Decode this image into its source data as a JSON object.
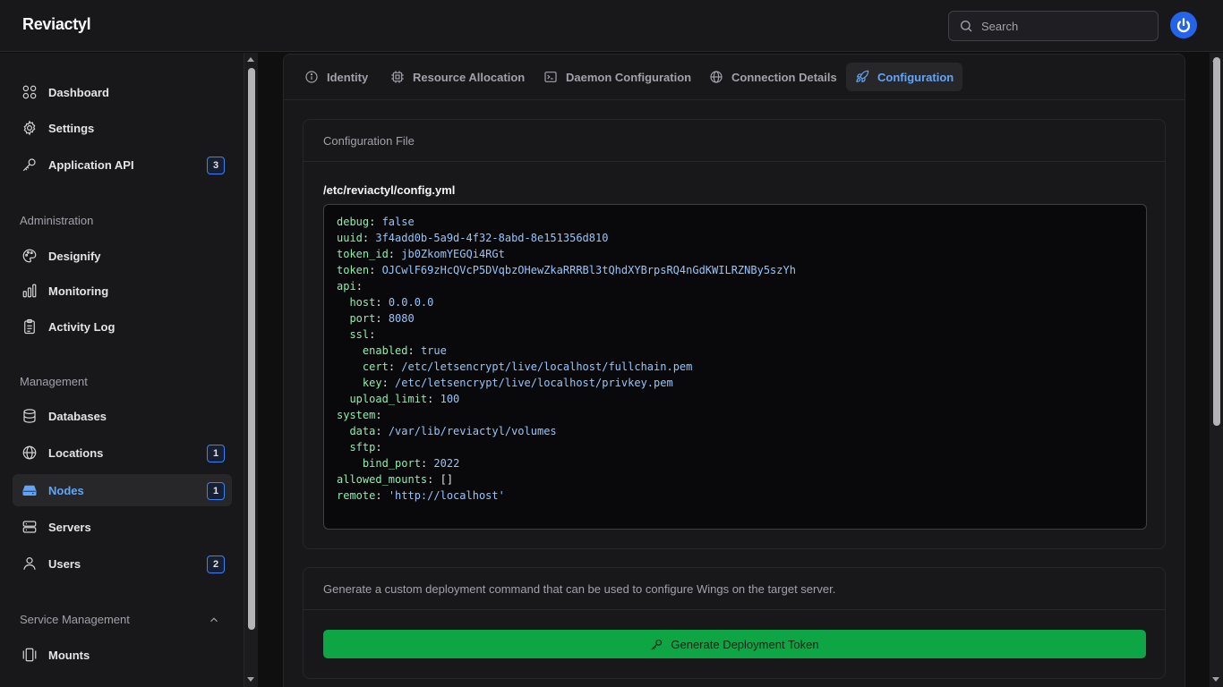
{
  "app": {
    "title": "Reviactyl"
  },
  "search": {
    "placeholder": "Search"
  },
  "sidebar": {
    "top_items": [
      {
        "label": "Dashboard",
        "icon": "grid-icon"
      },
      {
        "label": "Settings",
        "icon": "gear-icon"
      },
      {
        "label": "Application API",
        "icon": "key-icon",
        "badge": "3"
      }
    ],
    "sections": [
      {
        "label": "Administration",
        "items": [
          {
            "label": "Designify",
            "icon": "palette-icon"
          },
          {
            "label": "Monitoring",
            "icon": "bar-chart-icon"
          },
          {
            "label": "Activity Log",
            "icon": "clipboard-icon"
          }
        ]
      },
      {
        "label": "Management",
        "items": [
          {
            "label": "Databases",
            "icon": "database-icon"
          },
          {
            "label": "Locations",
            "icon": "globe-icon",
            "badge": "1"
          },
          {
            "label": "Nodes",
            "icon": "hard-drive-icon",
            "badge": "1",
            "active": true
          },
          {
            "label": "Servers",
            "icon": "server-icon"
          },
          {
            "label": "Users",
            "icon": "user-icon",
            "badge": "2"
          }
        ]
      },
      {
        "label": "Service Management",
        "items": [
          {
            "label": "Mounts",
            "icon": "mount-icon"
          }
        ]
      }
    ]
  },
  "tabs": [
    {
      "label": "Identity",
      "icon": "info-icon"
    },
    {
      "label": "Resource Allocation",
      "icon": "cpu-icon"
    },
    {
      "label": "Daemon Configuration",
      "icon": "terminal-icon"
    },
    {
      "label": "Connection Details",
      "icon": "globe-icon"
    },
    {
      "label": "Configuration",
      "icon": "rocket-icon",
      "active": true
    }
  ],
  "config_card": {
    "title": "Configuration File",
    "path": "/etc/reviactyl/config.yml",
    "lines": [
      {
        "indent": 0,
        "key": "debug",
        "value": "false"
      },
      {
        "indent": 0,
        "key": "uuid",
        "value": "3f4add0b-5a9d-4f32-8abd-8e151356d810"
      },
      {
        "indent": 0,
        "key": "token_id",
        "value": "jb0ZkomYEGQi4RGt"
      },
      {
        "indent": 0,
        "key": "token",
        "value": "OJCwlF69zHcQVcP5DVqbzOHewZkaRRRBl3tQhdXYBrpsRQ4nGdKWILRZNBy5szYh"
      },
      {
        "indent": 0,
        "key": "api",
        "value": ""
      },
      {
        "indent": 1,
        "key": "host",
        "value": "0.0.0.0"
      },
      {
        "indent": 1,
        "key": "port",
        "value": "8080"
      },
      {
        "indent": 1,
        "key": "ssl",
        "value": ""
      },
      {
        "indent": 2,
        "key": "enabled",
        "value": "true"
      },
      {
        "indent": 2,
        "key": "cert",
        "value": "/etc/letsencrypt/live/localhost/fullchain.pem"
      },
      {
        "indent": 2,
        "key": "key",
        "value": "/etc/letsencrypt/live/localhost/privkey.pem"
      },
      {
        "indent": 1,
        "key": "upload_limit",
        "value": "100"
      },
      {
        "indent": 0,
        "key": "system",
        "value": ""
      },
      {
        "indent": 1,
        "key": "data",
        "value": "/var/lib/reviactyl/volumes"
      },
      {
        "indent": 1,
        "key": "sftp",
        "value": ""
      },
      {
        "indent": 2,
        "key": "bind_port",
        "value": "2022"
      },
      {
        "indent": 0,
        "key": "allowed_mounts",
        "value": "[]",
        "plain": true
      },
      {
        "indent": 0,
        "key": "remote",
        "value": "'http://localhost'"
      }
    ]
  },
  "deploy_card": {
    "description": "Generate a custom deployment command that can be used to configure Wings on the target server.",
    "button_label": "Generate Deployment Token"
  },
  "colors": {
    "accent": "#60a5fa",
    "success": "#0ea544",
    "yaml_key": "#86efac",
    "yaml_value": "#93c5fd"
  }
}
